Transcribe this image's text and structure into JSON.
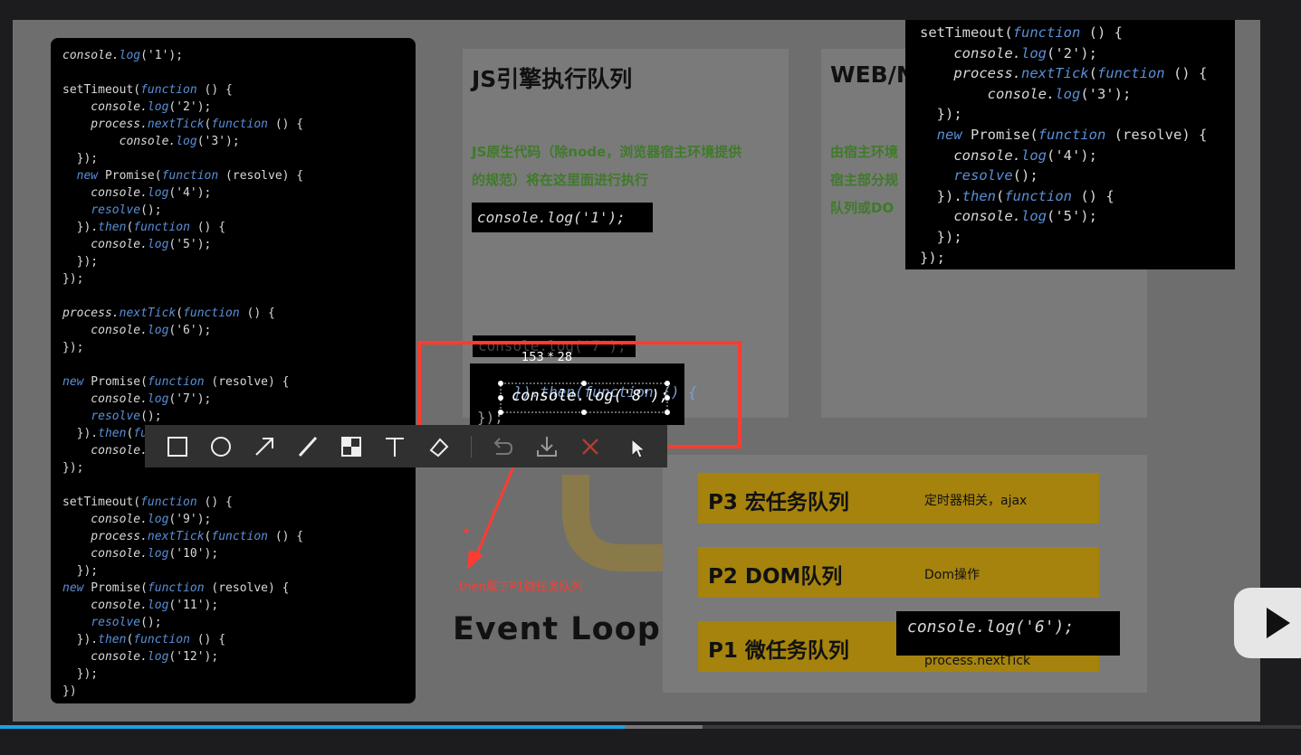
{
  "left_code": {
    "lines": [
      [
        {
          "t": "console.",
          "c": "obj"
        },
        {
          "t": "log",
          "c": "fn"
        },
        {
          "t": "('1');",
          "c": "str"
        }
      ],
      [],
      [
        {
          "t": "setTimeout(",
          "c": "str"
        },
        {
          "t": "function",
          "c": "kw"
        },
        {
          "t": " () {",
          "c": "str"
        }
      ],
      [
        {
          "t": "    console.",
          "c": "obj"
        },
        {
          "t": "log",
          "c": "fn"
        },
        {
          "t": "('2');",
          "c": "str"
        }
      ],
      [
        {
          "t": "    process.",
          "c": "obj"
        },
        {
          "t": "nextTick",
          "c": "fn"
        },
        {
          "t": "(",
          "c": "str"
        },
        {
          "t": "function",
          "c": "kw"
        },
        {
          "t": " () {",
          "c": "str"
        }
      ],
      [
        {
          "t": "        console.",
          "c": "obj"
        },
        {
          "t": "log",
          "c": "fn"
        },
        {
          "t": "('3');",
          "c": "str"
        }
      ],
      [
        {
          "t": "  });",
          "c": "str"
        }
      ],
      [
        {
          "t": "  ",
          "c": "str"
        },
        {
          "t": "new",
          "c": "kw"
        },
        {
          "t": " Promise(",
          "c": "str"
        },
        {
          "t": "function",
          "c": "kw"
        },
        {
          "t": " (resolve) {",
          "c": "str"
        }
      ],
      [
        {
          "t": "    console.",
          "c": "obj"
        },
        {
          "t": "log",
          "c": "fn"
        },
        {
          "t": "('4');",
          "c": "str"
        }
      ],
      [
        {
          "t": "    ",
          "c": "str"
        },
        {
          "t": "resolve",
          "c": "fn"
        },
        {
          "t": "();",
          "c": "str"
        }
      ],
      [
        {
          "t": "  }).",
          "c": "str"
        },
        {
          "t": "then",
          "c": "fn"
        },
        {
          "t": "(",
          "c": "str"
        },
        {
          "t": "function",
          "c": "kw"
        },
        {
          "t": " () {",
          "c": "str"
        }
      ],
      [
        {
          "t": "    console.",
          "c": "obj"
        },
        {
          "t": "log",
          "c": "fn"
        },
        {
          "t": "('5');",
          "c": "str"
        }
      ],
      [
        {
          "t": "  });",
          "c": "str"
        }
      ],
      [
        {
          "t": "});",
          "c": "str"
        }
      ],
      [],
      [
        {
          "t": "process.",
          "c": "obj"
        },
        {
          "t": "nextTick",
          "c": "fn"
        },
        {
          "t": "(",
          "c": "str"
        },
        {
          "t": "function",
          "c": "kw"
        },
        {
          "t": " () {",
          "c": "str"
        }
      ],
      [
        {
          "t": "    console.",
          "c": "obj"
        },
        {
          "t": "log",
          "c": "fn"
        },
        {
          "t": "('6');",
          "c": "str"
        }
      ],
      [
        {
          "t": "});",
          "c": "str"
        }
      ],
      [],
      [
        {
          "t": "new",
          "c": "kw"
        },
        {
          "t": " Promise(",
          "c": "str"
        },
        {
          "t": "function",
          "c": "kw"
        },
        {
          "t": " (resolve) {",
          "c": "str"
        }
      ],
      [
        {
          "t": "    console.",
          "c": "obj"
        },
        {
          "t": "log",
          "c": "fn"
        },
        {
          "t": "('7');",
          "c": "str"
        }
      ],
      [
        {
          "t": "    ",
          "c": "str"
        },
        {
          "t": "resolve",
          "c": "fn"
        },
        {
          "t": "();",
          "c": "str"
        }
      ],
      [
        {
          "t": "  }).",
          "c": "str"
        },
        {
          "t": "then",
          "c": "fn"
        },
        {
          "t": "(",
          "c": "str"
        },
        {
          "t": "fu",
          "c": "kw"
        }
      ],
      [
        {
          "t": "    console.",
          "c": "obj"
        }
      ],
      [
        {
          "t": "});",
          "c": "str"
        }
      ],
      [],
      [
        {
          "t": "setTimeout(",
          "c": "str"
        },
        {
          "t": "function",
          "c": "kw"
        },
        {
          "t": " () {",
          "c": "str"
        }
      ],
      [
        {
          "t": "    console.",
          "c": "obj"
        },
        {
          "t": "log",
          "c": "fn"
        },
        {
          "t": "('9');",
          "c": "str"
        }
      ],
      [
        {
          "t": "    process.",
          "c": "obj"
        },
        {
          "t": "nextTick",
          "c": "fn"
        },
        {
          "t": "(",
          "c": "str"
        },
        {
          "t": "function",
          "c": "kw"
        },
        {
          "t": " () {",
          "c": "str"
        }
      ],
      [
        {
          "t": "    console.",
          "c": "obj"
        },
        {
          "t": "log",
          "c": "fn"
        },
        {
          "t": "('10');",
          "c": "str"
        }
      ],
      [
        {
          "t": "  });",
          "c": "str"
        }
      ],
      [
        {
          "t": "new",
          "c": "kw"
        },
        {
          "t": " Promise(",
          "c": "str"
        },
        {
          "t": "function",
          "c": "kw"
        },
        {
          "t": " (resolve) {",
          "c": "str"
        }
      ],
      [
        {
          "t": "    console.",
          "c": "obj"
        },
        {
          "t": "log",
          "c": "fn"
        },
        {
          "t": "('11');",
          "c": "str"
        }
      ],
      [
        {
          "t": "    ",
          "c": "str"
        },
        {
          "t": "resolve",
          "c": "fn"
        },
        {
          "t": "();",
          "c": "str"
        }
      ],
      [
        {
          "t": "  }).",
          "c": "str"
        },
        {
          "t": "then",
          "c": "fn"
        },
        {
          "t": "(",
          "c": "str"
        },
        {
          "t": "function",
          "c": "kw"
        },
        {
          "t": " () {",
          "c": "str"
        }
      ],
      [
        {
          "t": "    console.",
          "c": "obj"
        },
        {
          "t": "log",
          "c": "fn"
        },
        {
          "t": "('12');",
          "c": "str"
        }
      ],
      [
        {
          "t": "  });",
          "c": "str"
        }
      ],
      [
        {
          "t": "})",
          "c": "str"
        }
      ]
    ]
  },
  "right_code": {
    "lines": [
      [
        {
          "t": "setTimeout(",
          "c": "str"
        },
        {
          "t": "function",
          "c": "kw"
        },
        {
          "t": " () {",
          "c": "str"
        }
      ],
      [
        {
          "t": "    console.",
          "c": "obj"
        },
        {
          "t": "log",
          "c": "fn"
        },
        {
          "t": "('2');",
          "c": "str"
        }
      ],
      [
        {
          "t": "    process.",
          "c": "obj"
        },
        {
          "t": "nextTick",
          "c": "fn"
        },
        {
          "t": "(",
          "c": "str"
        },
        {
          "t": "function",
          "c": "kw"
        },
        {
          "t": " () {",
          "c": "str"
        }
      ],
      [
        {
          "t": "        console.",
          "c": "obj"
        },
        {
          "t": "log",
          "c": "fn"
        },
        {
          "t": "('3');",
          "c": "str"
        }
      ],
      [
        {
          "t": "  });",
          "c": "str"
        }
      ],
      [
        {
          "t": "  ",
          "c": "str"
        },
        {
          "t": "new",
          "c": "kw"
        },
        {
          "t": " Promise(",
          "c": "str"
        },
        {
          "t": "function",
          "c": "kw"
        },
        {
          "t": " (resolve) {",
          "c": "str"
        }
      ],
      [
        {
          "t": "    console.",
          "c": "obj"
        },
        {
          "t": "log",
          "c": "fn"
        },
        {
          "t": "('4');",
          "c": "str"
        }
      ],
      [
        {
          "t": "    ",
          "c": "str"
        },
        {
          "t": "resolve",
          "c": "fn"
        },
        {
          "t": "();",
          "c": "str"
        }
      ],
      [
        {
          "t": "  }).",
          "c": "str"
        },
        {
          "t": "then",
          "c": "fn"
        },
        {
          "t": "(",
          "c": "str"
        },
        {
          "t": "function",
          "c": "kw"
        },
        {
          "t": " () {",
          "c": "str"
        }
      ],
      [
        {
          "t": "    console.",
          "c": "obj"
        },
        {
          "t": "log",
          "c": "fn"
        },
        {
          "t": "('5');",
          "c": "str"
        }
      ],
      [
        {
          "t": "  });",
          "c": "str"
        }
      ],
      [
        {
          "t": "});",
          "c": "str"
        }
      ]
    ]
  },
  "js_panel": {
    "title": "JS引擎执行队列",
    "desc_line1": "JS原生代码（除node，浏览器宿主环境提供",
    "desc_line2": "的规范）将在这里面进行执行",
    "chip1": "console.log('1');",
    "chip_partial": "console.log('7');",
    "chip_then_line": "}).then(function () {",
    "chip_log8": "console.log('8');",
    "chip_close": "});"
  },
  "web_panel": {
    "title": "WEB/N",
    "desc_line1": "由宿主环境",
    "desc_line2": "宿主部分规",
    "desc_line3": "队列或DO"
  },
  "queues": [
    {
      "title": "P3 宏任务队列",
      "desc": "定时器相关，ajax"
    },
    {
      "title": "P2 DOM队列",
      "desc": "Dom操作"
    },
    {
      "title": "P1 微任务队列",
      "desc": "process.nextTick"
    }
  ],
  "log6_chip": "console.log('6');",
  "event_loop_label": "Event Loop",
  "annotation": {
    "size_label": "153 * 28",
    "note": ".then属于P1微任务队列"
  },
  "toolbar": {
    "tools": [
      "rectangle-tool-icon",
      "ellipse-tool-icon",
      "arrow-tool-icon",
      "pen-tool-icon",
      "mosaic-tool-icon",
      "text-tool-icon",
      "eraser-tool-icon",
      "undo-icon",
      "download-icon",
      "cancel-icon",
      "confirm-icon"
    ]
  },
  "colors": {
    "annotation_red": "#ff3b30",
    "queue_gold": "#a5830d",
    "progress_blue": "#1aa1e6"
  },
  "player": {
    "progress": 0.48,
    "buffered": 0.54
  }
}
